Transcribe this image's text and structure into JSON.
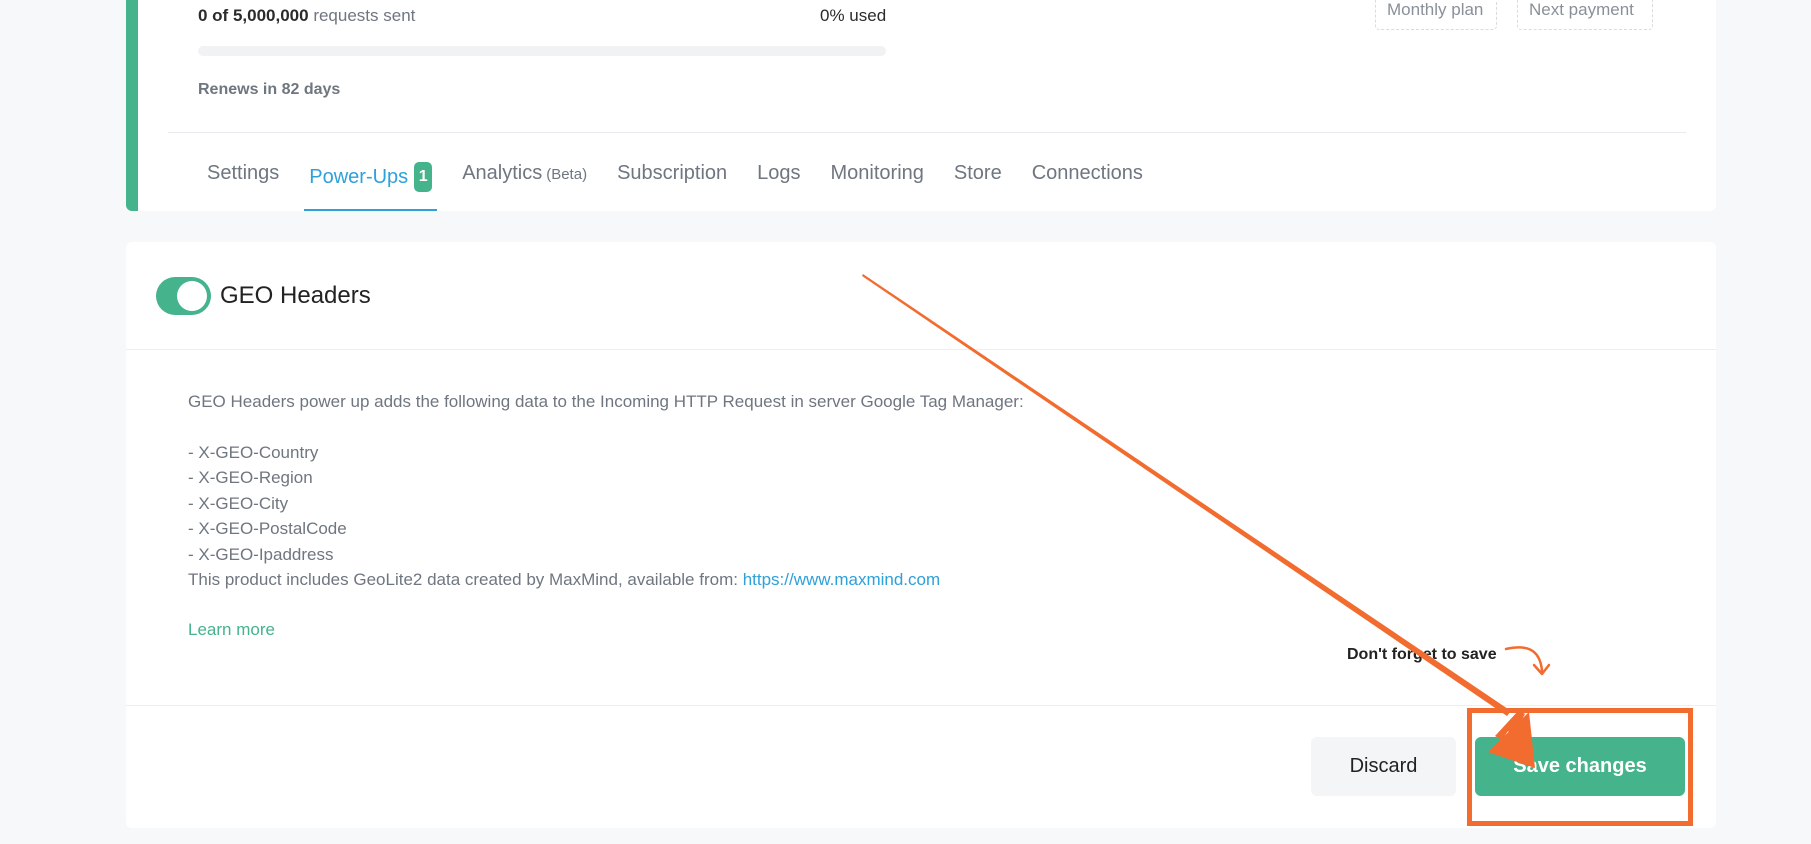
{
  "usage": {
    "count": "0 of 5,000,000",
    "count_suffix": "requests sent",
    "percent_label": "0% used",
    "progress_percent": 0,
    "renews": "Renews in 82 days"
  },
  "plan": {
    "monthly_label": "Monthly plan",
    "next_payment_label": "Next payment"
  },
  "tabs": [
    {
      "label": "Settings"
    },
    {
      "label": "Power-Ups",
      "badge": "1",
      "active": true
    },
    {
      "label": "Analytics",
      "suffix": "(Beta)"
    },
    {
      "label": "Subscription"
    },
    {
      "label": "Logs"
    },
    {
      "label": "Monitoring"
    },
    {
      "label": "Store"
    },
    {
      "label": "Connections"
    }
  ],
  "powerup": {
    "title": "GEO Headers",
    "enabled": true,
    "intro": "GEO Headers power up adds the following data to the Incoming HTTP Request in server Google Tag Manager:",
    "headers": [
      "- X-GEO-Country",
      "- X-GEO-Region",
      "- X-GEO-City",
      "- X-GEO-PostalCode",
      "- X-GEO-Ipaddress"
    ],
    "geolite_text": "This product includes GeoLite2 data created by MaxMind, available from: ",
    "geolite_link": "https://www.maxmind.com",
    "learn_more": "Learn more"
  },
  "footer": {
    "reminder": "Don't forget to save",
    "discard_label": "Discard",
    "save_label": "Save changes"
  },
  "colors": {
    "accent": "#45b38c",
    "link": "#2ea0da",
    "annotation": "#f26b2f"
  }
}
